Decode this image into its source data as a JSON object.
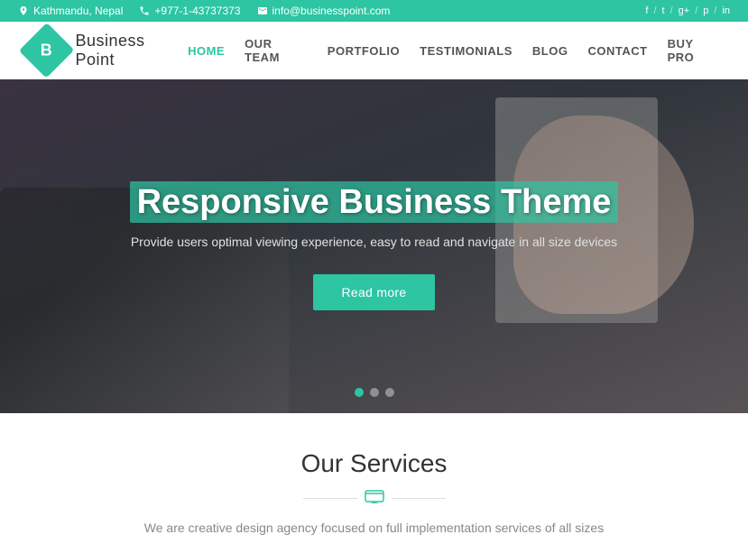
{
  "topbar": {
    "location": "Kathmandu, Nepal",
    "phone": "+977-1-43737373",
    "email": "info@businesspoint.com",
    "social": [
      "f",
      "/",
      "t",
      "/",
      "g+",
      "/",
      "p",
      "/",
      "in"
    ]
  },
  "logo": {
    "letter": "B",
    "name": "Business  Point"
  },
  "nav": {
    "items": [
      {
        "label": "HOME",
        "active": true
      },
      {
        "label": "OUR TEAM",
        "active": false
      },
      {
        "label": "PORTFOLIO",
        "active": false
      },
      {
        "label": "TESTIMONIALS",
        "active": false
      },
      {
        "label": "BLOG",
        "active": false
      },
      {
        "label": "CONTACT",
        "active": false
      },
      {
        "label": "BUY PRO",
        "active": false
      }
    ]
  },
  "hero": {
    "title_part1": "Responsive Business",
    "title_highlight": "Theme",
    "subtitle": "Provide users optimal viewing experience, easy to read and navigate in all size devices",
    "button_label": "Read more",
    "dots": [
      true,
      false,
      false
    ]
  },
  "services": {
    "title": "Our Services",
    "subtitle": "We are creative design agency focused on full implementation services of all sizes"
  }
}
